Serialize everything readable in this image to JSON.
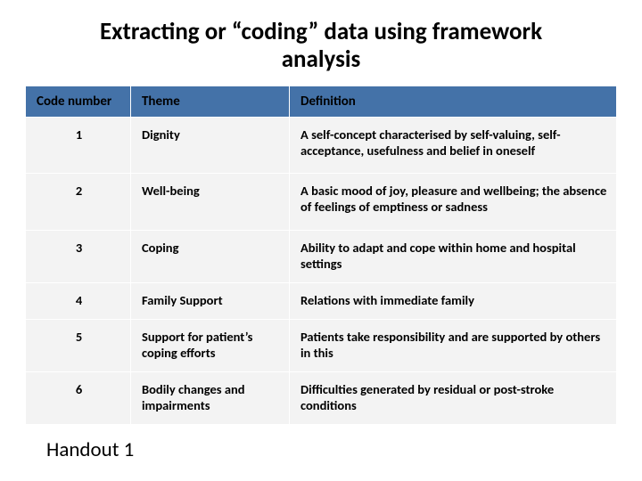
{
  "title": "Extracting or “coding” data using framework analysis",
  "columns": {
    "code": "Code number",
    "theme": "Theme",
    "definition": "Definition"
  },
  "rows": [
    {
      "code": "1",
      "theme": "Dignity",
      "definition": "A self-concept characterised by self-valuing, self-acceptance, usefulness and belief in oneself"
    },
    {
      "code": "2",
      "theme": "Well-being",
      "definition": "A basic mood of joy, pleasure and wellbeing; the absence of feelings of emptiness or sadness"
    },
    {
      "code": "3",
      "theme": "Coping",
      "definition": "Ability to adapt and cope within home and hospital settings"
    },
    {
      "code": "4",
      "theme": "Family Support",
      "definition": "Relations with immediate family"
    },
    {
      "code": "5",
      "theme": "Support for patient’s coping efforts",
      "definition": "Patients take responsibility and are supported by others in this"
    },
    {
      "code": "6",
      "theme": "Bodily changes and impairments",
      "definition": "Difficulties generated by residual or post-stroke conditions"
    }
  ],
  "footer": "Handout 1"
}
